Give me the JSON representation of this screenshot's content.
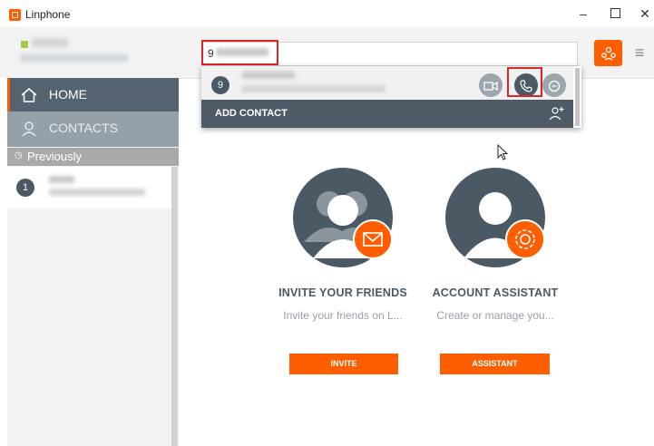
{
  "window": {
    "title": "Linphone",
    "minimize": "–",
    "close": "✕"
  },
  "topbar": {
    "search_value": "9",
    "conference_icon": "conference-icon",
    "menu_icon": "≡"
  },
  "sidebar": {
    "home_label": "HOME",
    "contacts_label": "CONTACTS",
    "previously_label": "Previously",
    "recent_badge": "1"
  },
  "dropdown": {
    "result_badge": "9",
    "add_contact_label": "ADD CONTACT"
  },
  "cards": {
    "invite": {
      "title": "INVITE YOUR FRIENDS",
      "description": "Invite your friends on L...",
      "button": "INVITE"
    },
    "assistant": {
      "title": "ACCOUNT ASSISTANT",
      "description": "Create or manage you...",
      "button": "ASSISTANT"
    }
  },
  "colors": {
    "accent": "#ff5e00",
    "dark": "#4b5964",
    "highlight": "#e0242c"
  }
}
